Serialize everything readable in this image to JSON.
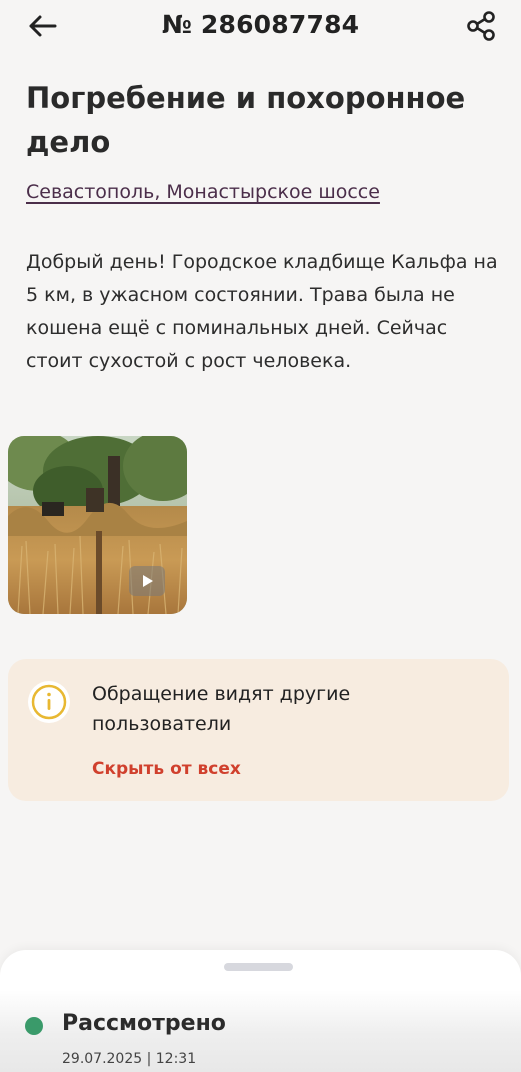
{
  "header": {
    "title": "№ 286087784",
    "back_icon": "arrow-left-icon",
    "share_icon": "share-icon"
  },
  "appeal": {
    "title": "Погребение и похоронное дело",
    "address": "Севастополь, Монастырское шоссе",
    "description": "Добрый день! Городское кладбище Кальфа на 5 км, в ужасном состоянии. Трава была не кошена ещё с поминальных дней. Сейчас стоит сухостой с рост человека."
  },
  "media": {
    "type": "video",
    "play_icon": "play-icon"
  },
  "notice": {
    "icon": "info-icon",
    "text": "Обращение видят другие пользователи",
    "action": "Скрыть от всех"
  },
  "status": {
    "label": "Рассмотрено",
    "date": "29.07.2025 | 12:31",
    "color": "#3a9a6a"
  },
  "colors": {
    "accent_red": "#d0402d",
    "notice_bg": "#f7ece0",
    "info_yellow": "#e8b832",
    "link_purple": "#4b2e4a"
  }
}
